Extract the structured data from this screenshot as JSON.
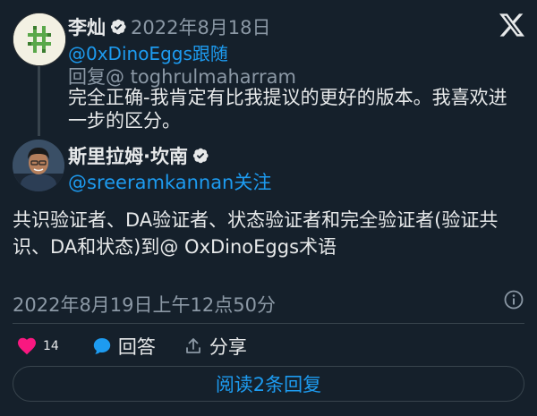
{
  "parent_tweet": {
    "author_name": "李灿",
    "date": "2022年8月18日",
    "handle": "@0xDinoEggs",
    "follow_label": "跟随",
    "reply_to": "回复@ toghrulmaharram",
    "text": "完全正确-我肯定有比我提议的更好的版本。我喜欢进一步的区分。",
    "avatar_icon": "hashtag-pixel-avatar-icon"
  },
  "main_tweet": {
    "author_name": "斯里拉姆·坎南",
    "handle": "@sreeramkannan",
    "follow_label": "关注",
    "text": "共识验证者、DA验证者、状态验证者和完全验证者(验证共识、DA和状态)到@ OxDinoEggs术语",
    "timestamp": "2022年8月19日上午12点50分"
  },
  "actions": {
    "like_count": "14",
    "reply_label": "回答",
    "share_label": "分享"
  },
  "read_replies_label": "阅读2条回复",
  "colors": {
    "background": "#15202b",
    "accent": "#1d9bf0",
    "like": "#f91880",
    "muted": "#8b98a5"
  },
  "icons": {
    "logo": "x-logo-icon",
    "verified": "verified-badge-icon",
    "info": "info-icon",
    "like": "heart-icon",
    "reply": "speech-bubble-icon",
    "share": "share-icon"
  }
}
